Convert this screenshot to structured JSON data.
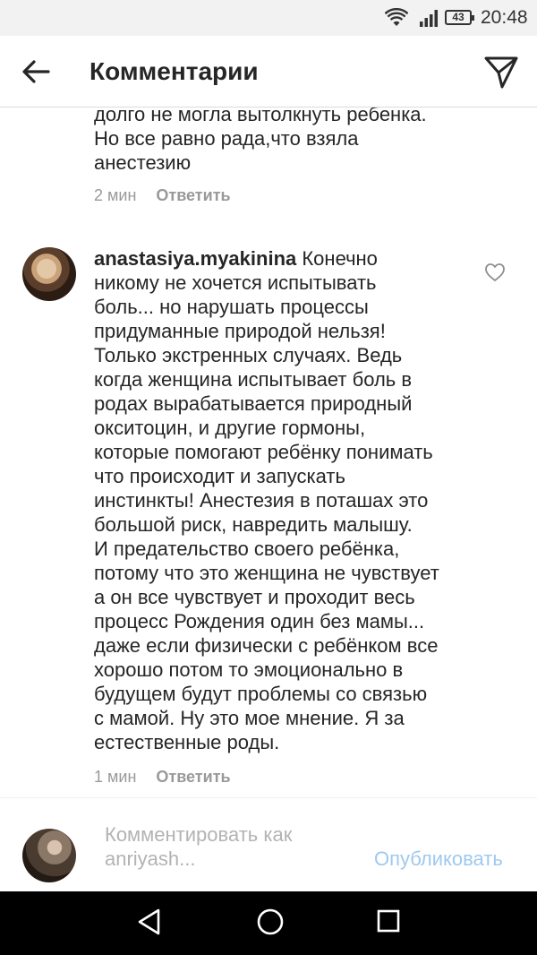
{
  "status_bar": {
    "battery": "43",
    "time": "20:48"
  },
  "header": {
    "title": "Комментарии"
  },
  "comments": [
    {
      "text": "долго не могла вытолкнуть ребенка.\nНо все равно рада,что взяла\nанестезию",
      "time": "2 мин",
      "reply_label": "Ответить"
    },
    {
      "username": "anastasiya.myakinina",
      "text": " Конечно\nникому не хочется испытывать\nболь... но нарушать процессы\nпридуманные природой нельзя!\nТолько экстренных случаях. Ведь\nкогда женщина испытывает боль в\nродах вырабатывается природный\nокситоцин, и другие гормоны,\nкоторые помогают ребёнку понимать\nчто происходит и запускать\nинстинкты! Анестезия в поташах это\nбольшой риск, навредить малышу.\nИ предательство своего ребёнка,\nпотому что это женщина не чувствует\nа он все чувствует и проходит весь\nпроцесс Рождения один без мамы...\nдаже если физически с ребёнком все\nхорошо потом то эмоционально в\nбудущем будут проблемы со связью\nс мамой. Ну это мое мнение. Я за\nестественные роды.",
      "time": "1 мин",
      "reply_label": "Ответить"
    }
  ],
  "composer": {
    "placeholder": "Комментировать как\nanriyash...",
    "publish_label": "Опубликовать"
  },
  "icons": {
    "back": "arrow-left-icon",
    "send": "paper-plane-icon",
    "like": "heart-outline-icon",
    "wifi": "wifi-icon",
    "signal": "signal-icon",
    "nav_back": "triangle-back-icon",
    "nav_home": "circle-home-icon",
    "nav_recents": "square-recents-icon"
  },
  "colors": {
    "publish": "#9fc9ee",
    "muted": "#999999",
    "text": "#262626"
  }
}
